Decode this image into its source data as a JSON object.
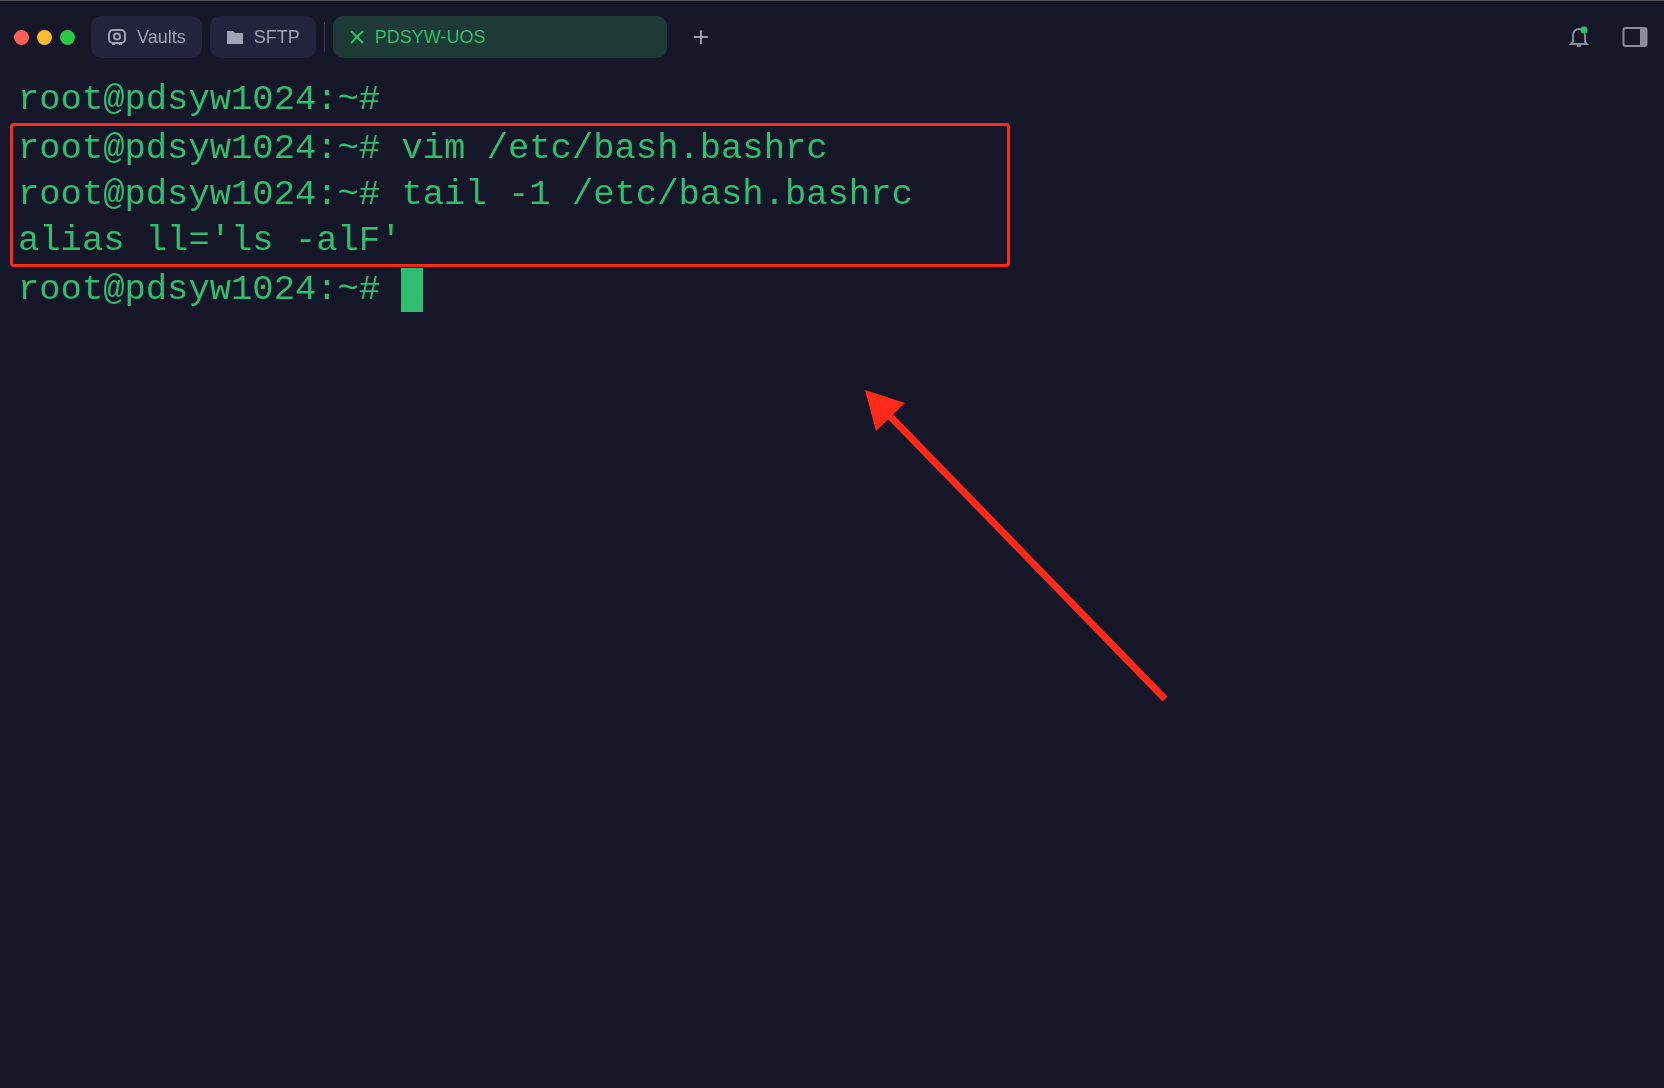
{
  "tabs": [
    {
      "label": "Vaults",
      "kind": "vaults",
      "selected": false
    },
    {
      "label": "SFTP",
      "kind": "sftp",
      "selected": false
    },
    {
      "label": "PDSYW-UOS",
      "kind": "session",
      "selected": true
    }
  ],
  "new_tab": "+",
  "notifications": {
    "unread": true
  },
  "terminal": {
    "lines": [
      {
        "kind": "prompt",
        "prompt": "root@pdsyw1024:~#",
        "highlighted": false,
        "cursor": false
      },
      {
        "kind": "prompt",
        "prompt": "root@pdsyw1024:~#",
        "command": "vim /etc/bash.bashrc",
        "highlighted": true,
        "cursor": false
      },
      {
        "kind": "prompt",
        "prompt": "root@pdsyw1024:~#",
        "command": "tail -1 /etc/bash.bashrc",
        "highlighted": true,
        "cursor": false
      },
      {
        "kind": "output",
        "text": "alias ll='ls -alF'",
        "highlighted": true,
        "cursor": false
      },
      {
        "kind": "prompt",
        "prompt": "root@pdsyw1024:~#",
        "highlighted": false,
        "cursor": true
      }
    ]
  },
  "annotations": [
    {
      "kind": "arrow"
    }
  ]
}
